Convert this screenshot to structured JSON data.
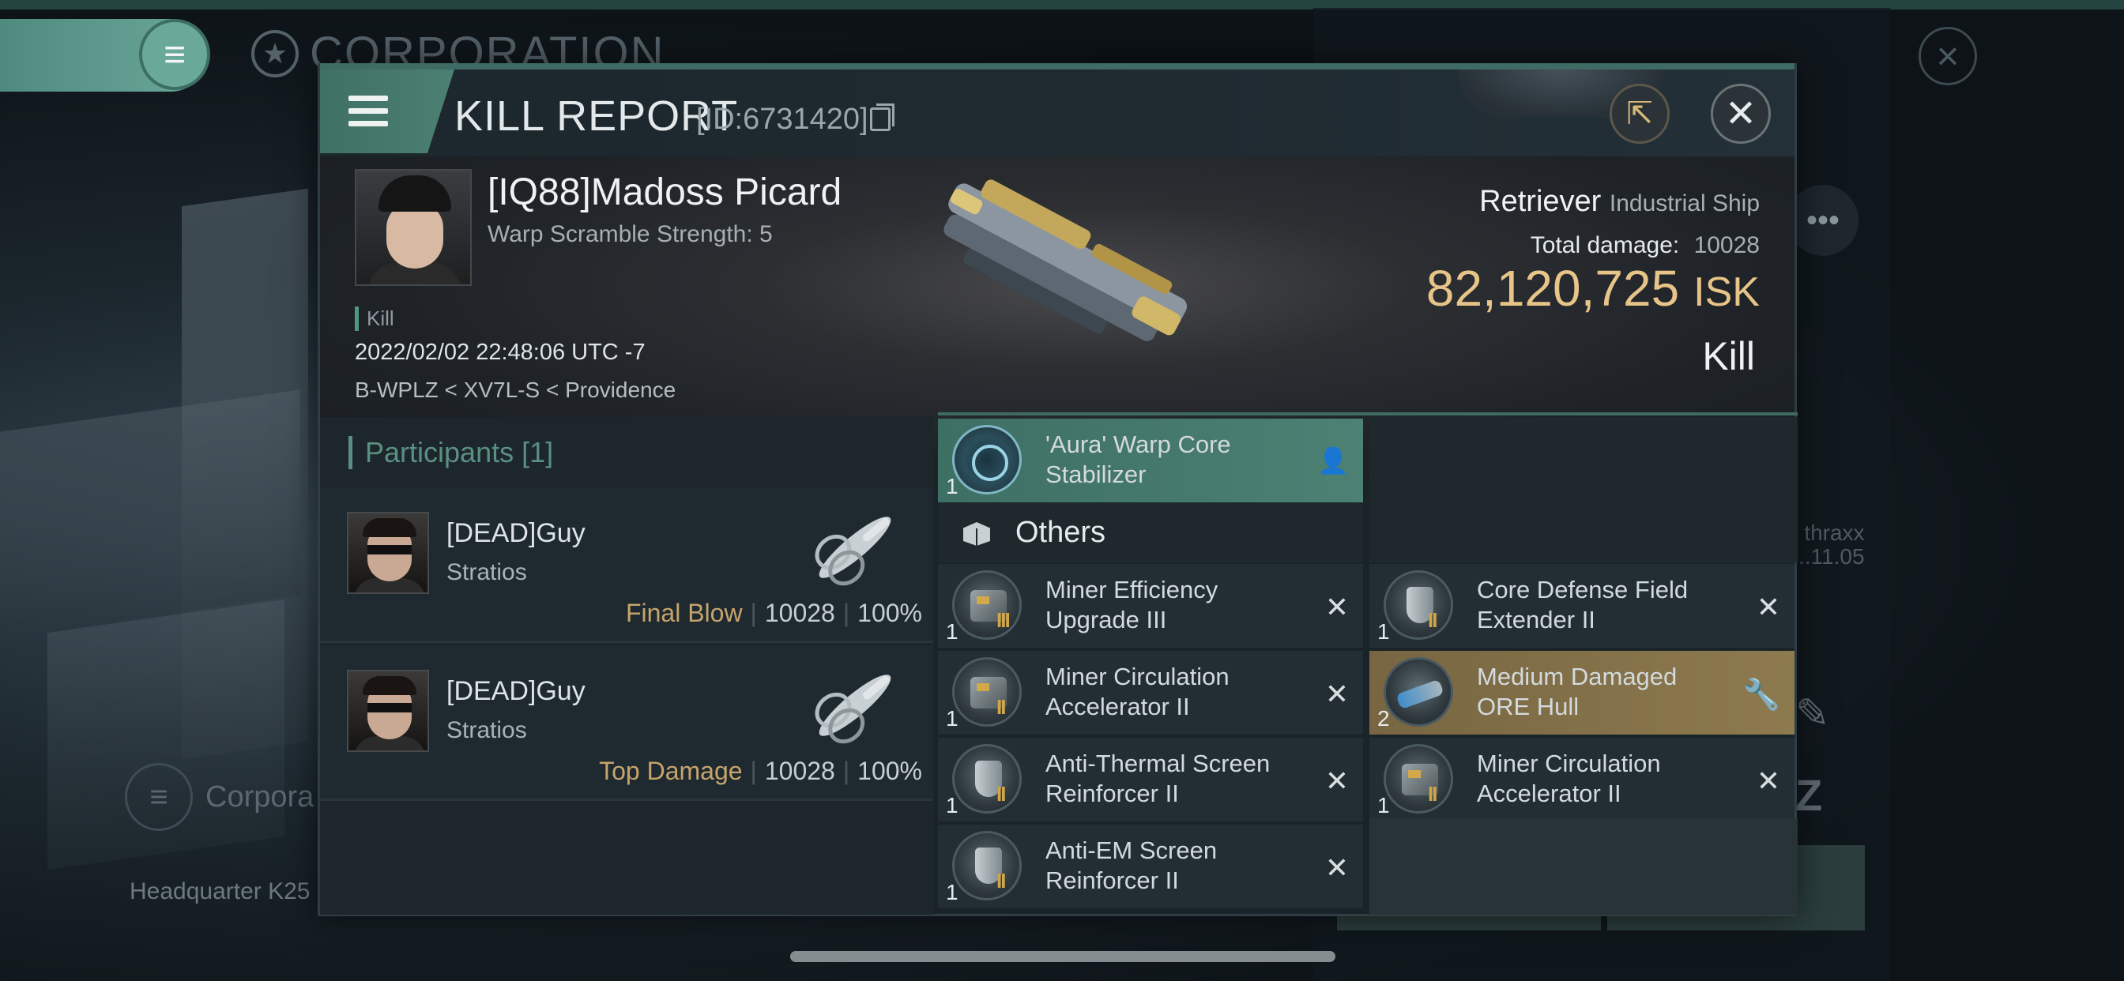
{
  "background": {
    "corp_title": "CORPORATION",
    "thraxx_name": "thraxx",
    "thraxx_date": "..11.05",
    "corpo_label": "Corpora",
    "hq_label": "Headquarter K25"
  },
  "header": {
    "title": "KILL REPORT",
    "id": "[ID:6731420]"
  },
  "victim": {
    "name": "[IQ88]Madoss Picard",
    "warp_scramble": "Warp Scramble Strength: 5",
    "tag": "Kill",
    "datetime": "2022/02/02 22:48:06 UTC -7",
    "location": "B-WPLZ < XV7L-S < Providence"
  },
  "ship": {
    "name": "Retriever",
    "class": "Industrial Ship",
    "total_damage_label": "Total damage:",
    "total_damage": "10028",
    "isk_value": "82,120,725",
    "isk_unit": "ISK",
    "result": "Kill"
  },
  "participants": {
    "header": "Participants [1]",
    "rows": [
      {
        "name": "[DEAD]Guy",
        "ship": "Stratios",
        "role": "Final Blow",
        "damage": "10028",
        "percent": "100%"
      },
      {
        "name": "[DEAD]Guy",
        "ship": "Stratios",
        "role": "Top Damage",
        "damage": "10028",
        "percent": "100%"
      }
    ]
  },
  "items": {
    "others_label": "Others",
    "top_item": {
      "name": "'Aura' Warp Core Stabilizer",
      "qty": "1"
    },
    "left": [
      {
        "name": "Miner Efficiency Upgrade III",
        "qty": "1",
        "tier": "III"
      },
      {
        "name": "Miner Circulation Accelerator II",
        "qty": "1",
        "tier": "II"
      },
      {
        "name": "Anti-Thermal Screen Reinforcer II",
        "qty": "1",
        "tier": "II"
      },
      {
        "name": "Anti-EM Screen Reinforcer II",
        "qty": "1",
        "tier": "II"
      }
    ],
    "right": [
      {
        "name": "Core Defense Field Extender II",
        "qty": "1",
        "tier": "II"
      },
      {
        "name": "Medium Damaged ORE Hull",
        "qty": "2",
        "tier": ""
      },
      {
        "name": "Miner Circulation Accelerator II",
        "qty": "1",
        "tier": "II"
      }
    ]
  },
  "colors": {
    "accent": "#4c8174",
    "isk": "#e7c487",
    "final_blow": "#c7a46b",
    "highlight_gold": "#8d7a4f"
  },
  "icons": [
    "menu-icon",
    "copy-icon",
    "export-icon",
    "close-icon",
    "cube-icon",
    "person-icon",
    "wrench-icon",
    "remove-icon"
  ]
}
